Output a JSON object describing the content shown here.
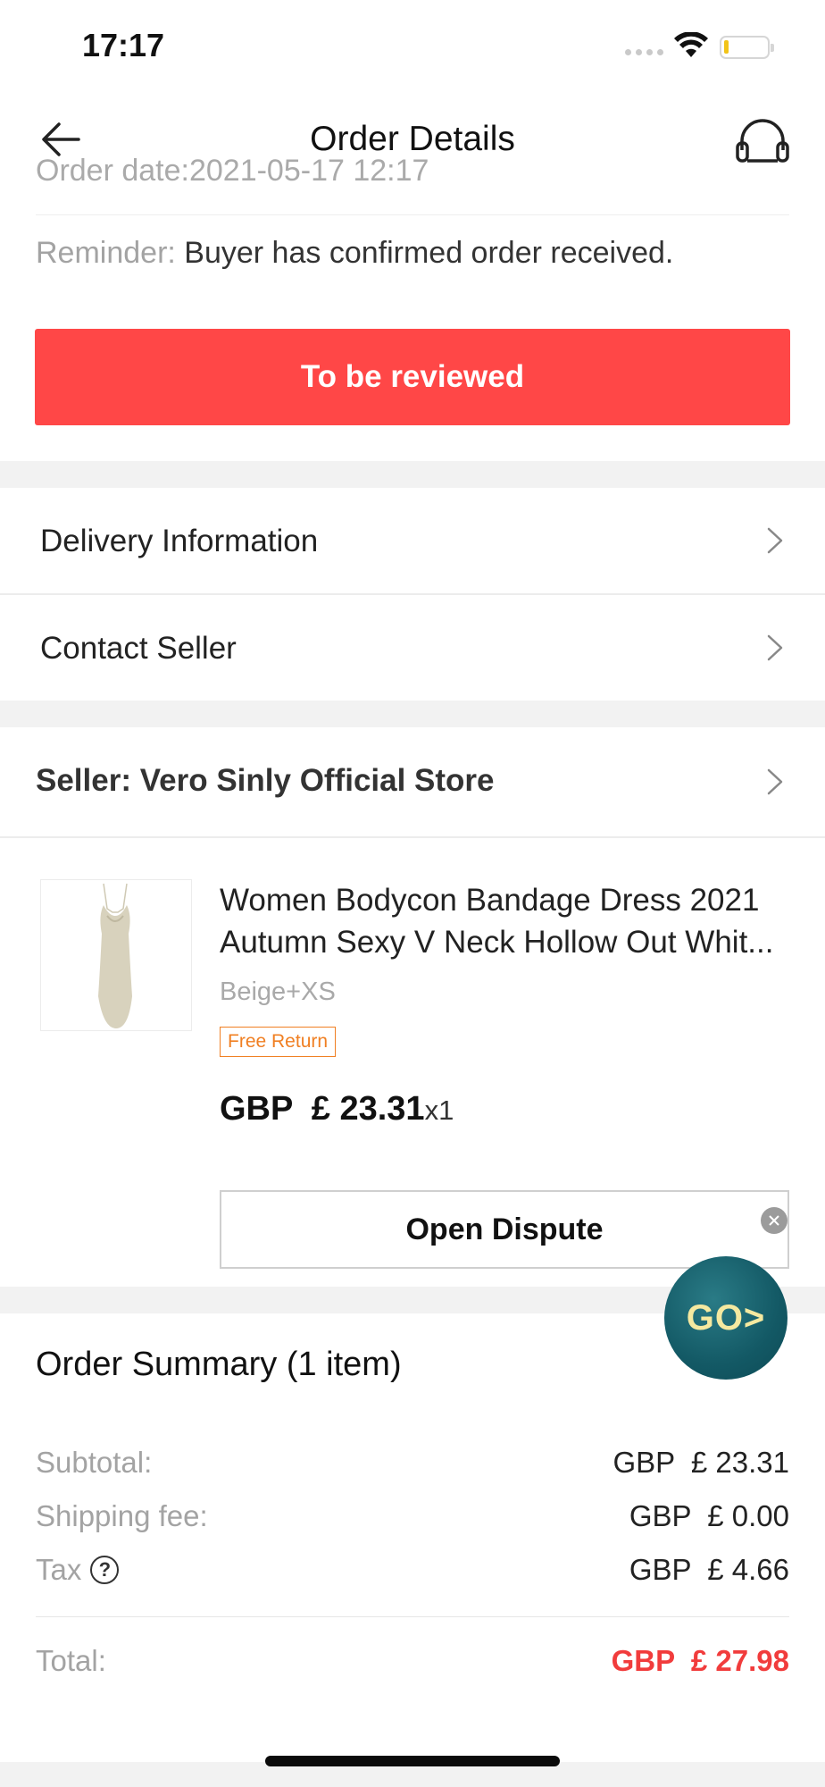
{
  "status_bar": {
    "time": "17:17"
  },
  "nav": {
    "title": "Order Details"
  },
  "order": {
    "date_partial": "Order date:2021-05-17 12:17",
    "reminder_label": "Reminder:",
    "reminder_text": "Buyer has confirmed order received.",
    "primary_action": "To be reviewed"
  },
  "links": {
    "delivery": "Delivery Information",
    "contact": "Contact Seller"
  },
  "seller": {
    "label": "Seller: Vero Sinly Official Store"
  },
  "product": {
    "title_line1": "Women Bodycon Bandage Dress 2021",
    "title_line2": "Autumn  Sexy V Neck Hollow Out Whit...",
    "variant": "Beige+XS",
    "badge": "Free Return",
    "price": "GBP  £ 23.31",
    "quantity": "x1",
    "dispute_button": "Open Dispute",
    "image_icon": "dress-thumbnail"
  },
  "promo": {
    "label": "GO>"
  },
  "summary": {
    "title": "Order Summary (1 item)",
    "subtotal_label": "Subtotal:",
    "subtotal_value": "GBP  £ 23.31",
    "shipping_label": "Shipping fee:",
    "shipping_value": "GBP  £ 0.00",
    "tax_label": "Tax",
    "tax_value": "GBP  £ 4.66",
    "total_label": "Total:",
    "total_value": "GBP  £ 27.98"
  },
  "colors": {
    "accent_red": "#ff4747",
    "total_red": "#f13c3c",
    "badge_orange": "#f07f22"
  }
}
